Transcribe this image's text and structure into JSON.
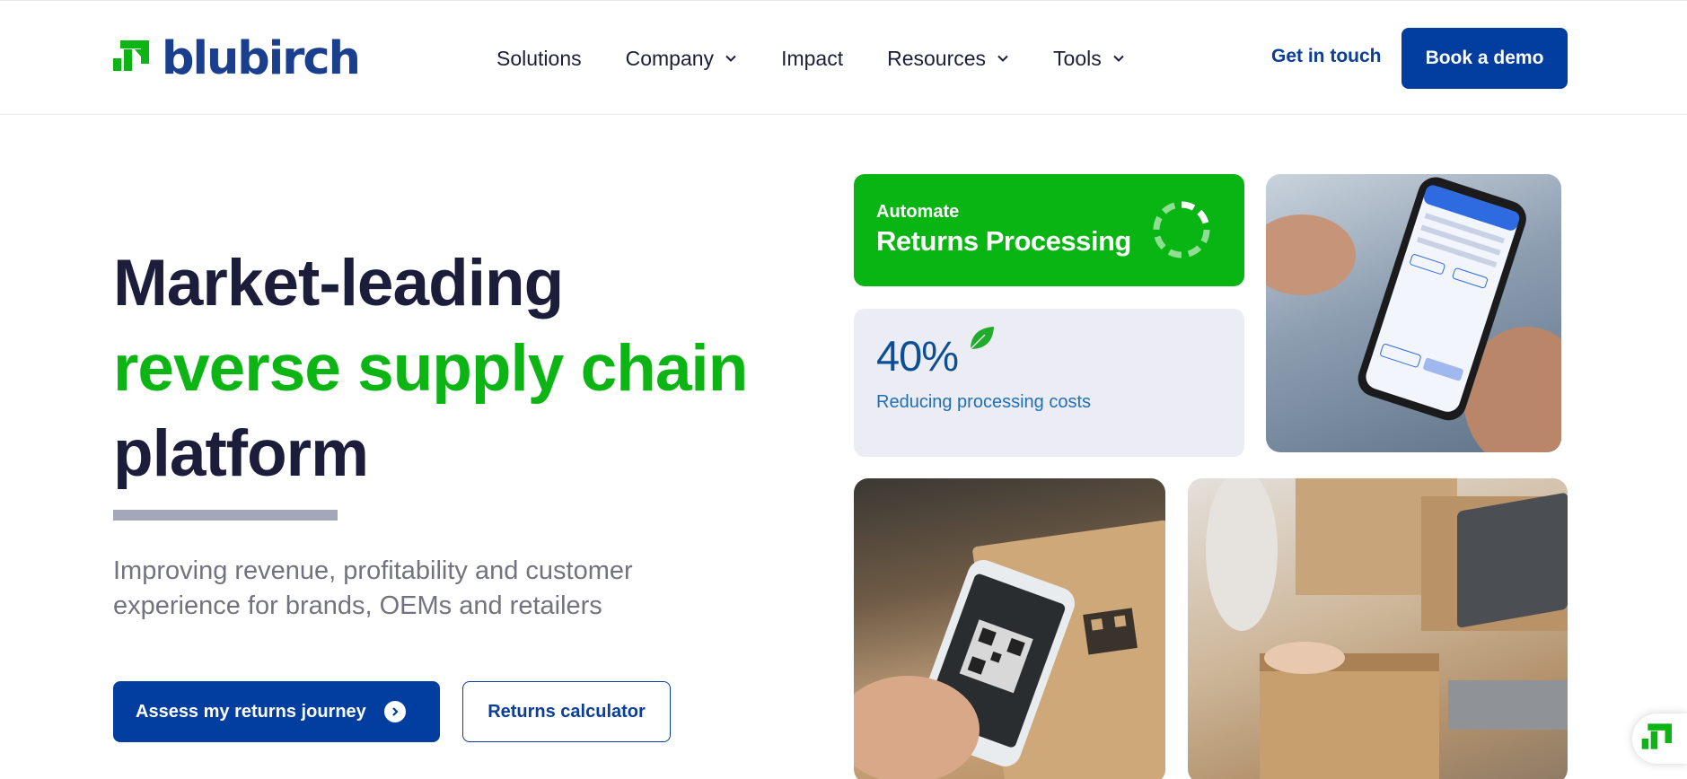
{
  "brand": {
    "name": "blubirch",
    "logo_icon": "blubirch-logo-icon",
    "colors": {
      "navy": "#023ea0",
      "green": "#09b512",
      "text": "#1c1d3a"
    }
  },
  "nav": {
    "items": [
      {
        "label": "Solutions",
        "dropdown": false
      },
      {
        "label": "Company",
        "dropdown": true
      },
      {
        "label": "Impact",
        "dropdown": false
      },
      {
        "label": "Resources",
        "dropdown": true
      },
      {
        "label": "Tools",
        "dropdown": true
      }
    ],
    "get_in_touch": "Get in touch",
    "book_demo": "Book a demo"
  },
  "hero": {
    "title_line1": "Market-leading",
    "title_line2": "reverse supply chain",
    "title_line3": "platform",
    "subtitle": "Improving revenue, profitability and customer experience for brands, OEMs and retailers",
    "primary_cta": "Assess my returns journey",
    "secondary_cta": "Returns calculator"
  },
  "feature_card": {
    "kicker": "Automate",
    "title": "Returns Processing",
    "icon": "progress-ring-icon"
  },
  "stat_card": {
    "value": "40%",
    "label": "Reducing processing costs",
    "icon": "leaf-icon"
  },
  "photos": [
    {
      "name": "photo-phone-app",
      "description_icon": "image"
    },
    {
      "name": "photo-qr-scan",
      "description_icon": "image"
    },
    {
      "name": "photo-packing-desk",
      "description_icon": "image"
    }
  ],
  "chat_widget": {
    "icon": "blubirch-logo-icon"
  }
}
